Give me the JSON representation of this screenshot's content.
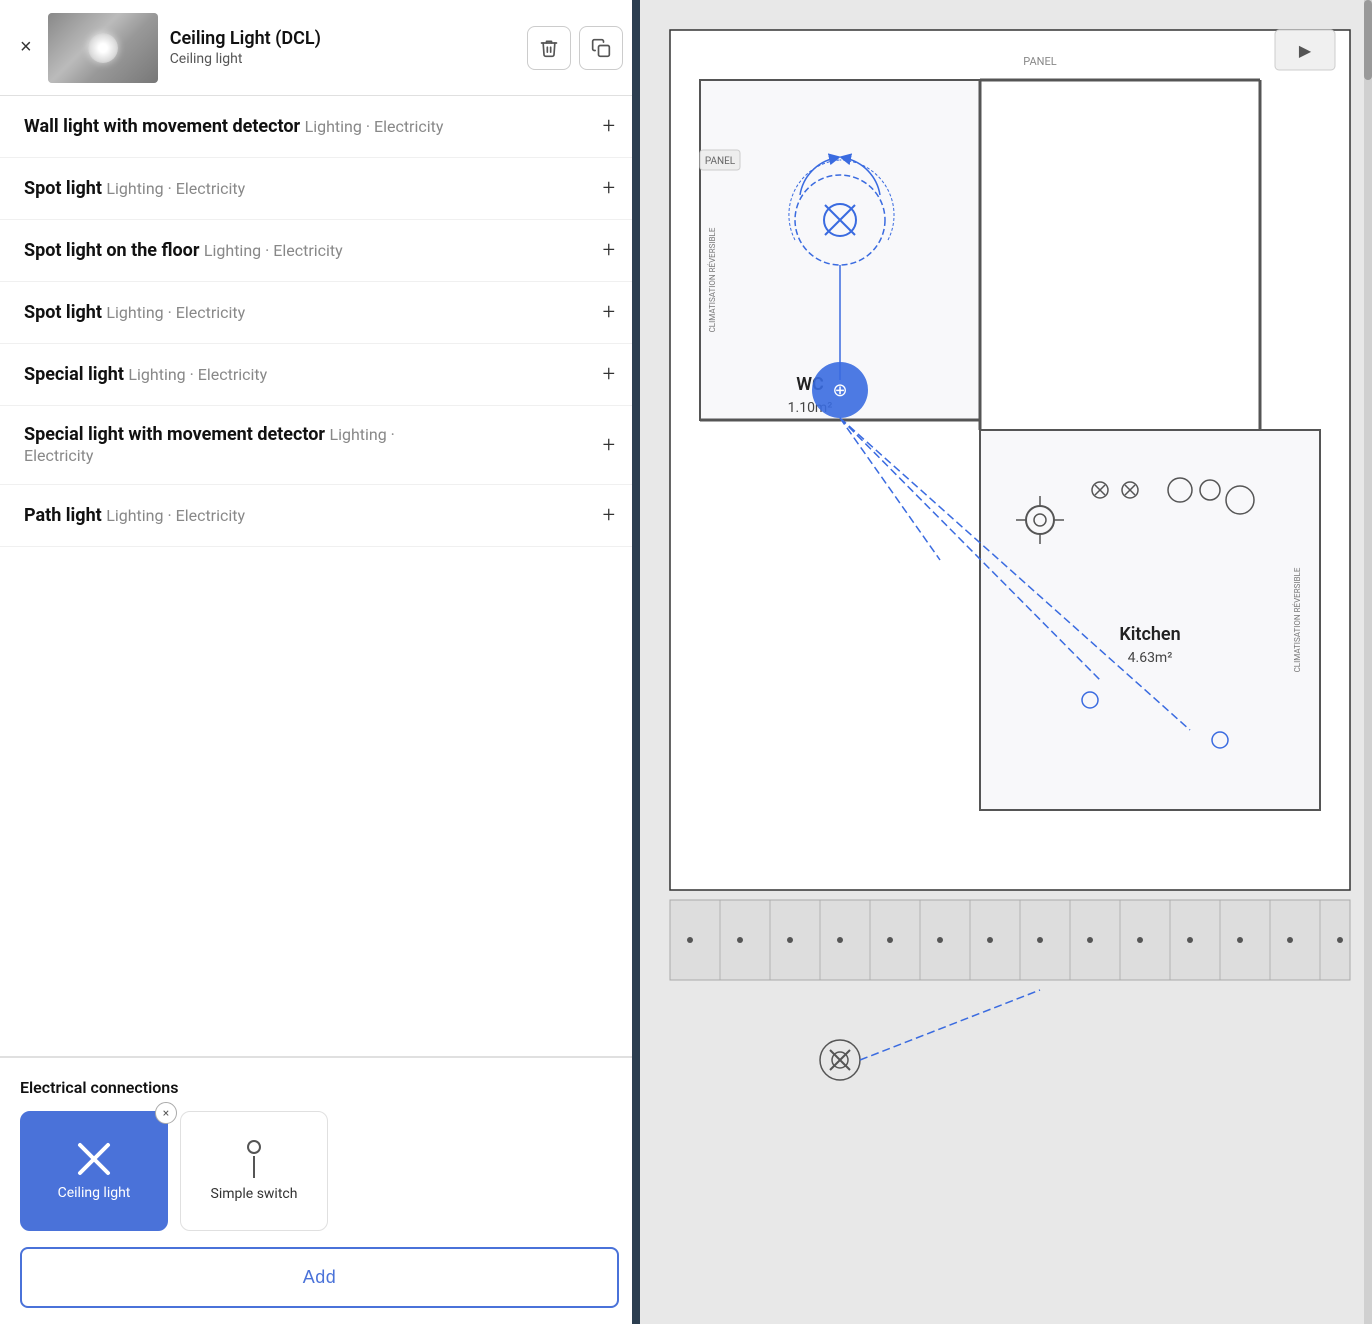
{
  "header": {
    "title": "Ceiling Light (DCL)",
    "subtitle": "Ceiling light",
    "close_label": "×",
    "delete_icon": "🗑",
    "copy_icon": "⧉"
  },
  "list_items": [
    {
      "name": "Wall light with movement detector",
      "tags": "Lighting · Electricity"
    },
    {
      "name": "Spot light",
      "tags": "Lighting · Electricity"
    },
    {
      "name": "Spot light on the floor",
      "tags": "Lighting · Electricity"
    },
    {
      "name": "Spot light",
      "tags": "Lighting · Electricity"
    },
    {
      "name": "Special light",
      "tags": "Lighting · Electricity"
    },
    {
      "name": "Special light with movement detector",
      "tags": "Lighting · Electricity"
    },
    {
      "name": "Path light",
      "tags": "Lighting · Electricity"
    }
  ],
  "electrical_section": {
    "title": "Electrical connections",
    "connections": [
      {
        "label": "Ceiling light",
        "active": true,
        "icon_type": "cross"
      },
      {
        "label": "Simple switch",
        "active": false,
        "icon_type": "switch"
      }
    ],
    "add_button_label": "Add"
  },
  "floorplan": {
    "rooms": [
      {
        "label": "WC",
        "area": "1.10m²"
      },
      {
        "label": "Kitchen",
        "area": "4.63m²"
      }
    ]
  }
}
